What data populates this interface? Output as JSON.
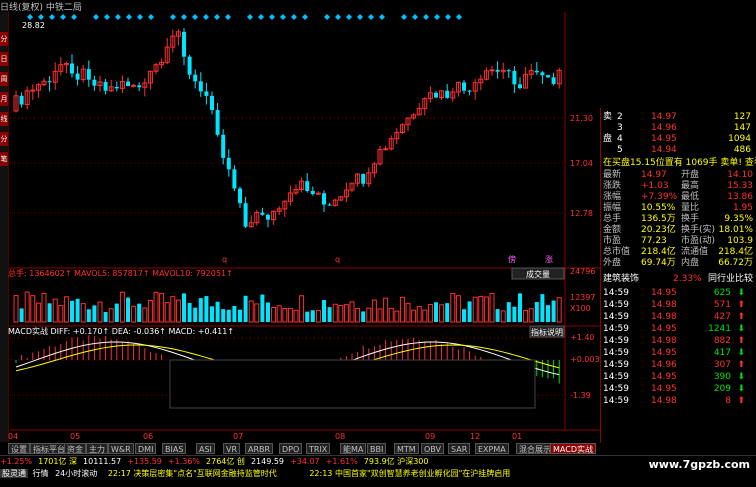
{
  "title": "日线(复权) 中铁二局",
  "left_buttons": [
    "分",
    "日",
    "周",
    "月",
    "线",
    "分",
    "笔"
  ],
  "price_axis": [
    "21.30",
    "17.04",
    "12.78"
  ],
  "max_label": "28.82",
  "markers": [
    "q",
    "q",
    "傍",
    "涨"
  ],
  "volume": {
    "label": "总手: 1364602↑  MAVOL5: 857817↑  MAVOL10: 792051↑",
    "type_button": "成交量",
    "axis": [
      "24796",
      "12397",
      "X100"
    ]
  },
  "macd": {
    "label": "MACD实战  DIFF: +0.170↑  DEA: -0.036↑  MACD: +0.411↑",
    "button": "指标说明",
    "axis": [
      "+1.40",
      "+0.003",
      "-1.39"
    ]
  },
  "x_axis": [
    "04",
    "05",
    "06",
    "07",
    "08",
    "09",
    "12",
    "01"
  ],
  "tabs": [
    "设置",
    "指标平台",
    "资金",
    "主力",
    "W&R",
    "DMI",
    "BIAS",
    "ASI",
    "VR",
    "ARBR",
    "DPO",
    "TRIX",
    "能MA",
    "BBI",
    "MTM",
    "OBV",
    "SAR",
    "EXPMA",
    "混合展示",
    "MACD实战"
  ],
  "ticker": [
    {
      "t": "+1.25%",
      "c": "red"
    },
    {
      "t": "1701亿 深",
      "c": "yellow"
    },
    {
      "t": "10111.57",
      "c": "white"
    },
    {
      "t": "+135.59",
      "c": "red"
    },
    {
      "t": "+1.36%",
      "c": "red"
    },
    {
      "t": "2764亿 创",
      "c": "yellow"
    },
    {
      "t": "2149.59",
      "c": "white"
    },
    {
      "t": "+34.07",
      "c": "red"
    },
    {
      "t": "+1.61%",
      "c": "red"
    },
    {
      "t": "793.9亿 沪深300",
      "c": "yellow"
    }
  ],
  "ticker2": {
    "tab1": "股灵通",
    "tab2": "行情",
    "tab3": "24小时滚动",
    "news1": "22:17 决策层密集\"点名\"互联网金融持监管时代",
    "news2": "22:13 中国首家\"双创智慧养老创业孵化园\"在沪挂牌启用"
  },
  "watermark": "www.7gpzb.com",
  "panel": {
    "sell_label": "卖",
    "buy_label": "盘",
    "sell_rows": [
      {
        "n": "2",
        "p": "14.97",
        "v": "127"
      },
      {
        "n": "3",
        "p": "14.96",
        "v": "147"
      },
      {
        "n": "4",
        "p": "14.95",
        "v": "1094"
      },
      {
        "n": "5",
        "p": "14.94",
        "v": "486"
      }
    ],
    "buy_info": "在买盘15.15位置有 1069手  卖单! 查看详细",
    "stats": [
      [
        "最新",
        "14.97",
        "开盘",
        "14.10"
      ],
      [
        "涨跌",
        "+1.03",
        "最高",
        "15.33"
      ],
      [
        "涨幅",
        "+7.39%",
        "最低",
        "13.86"
      ],
      [
        "振幅",
        "10.55%",
        "量比",
        "1.95"
      ],
      [
        "总手",
        "136.5万",
        "换手",
        "9.35%"
      ],
      [
        "金额",
        "20.23亿",
        "换手(实)",
        "18.01%"
      ],
      [
        "市盈",
        "77.23",
        "市盈(动)",
        "103.9"
      ],
      [
        "总市值",
        "218.4亿",
        "流通值",
        "218.4亿"
      ],
      [
        "外盘",
        "69.74万",
        "内盘",
        "66.72万"
      ]
    ],
    "industry": "建筑装饰",
    "industry_chg": "2.33%",
    "industry_link": "同行业比较",
    "ticks": [
      {
        "t": "14:59",
        "p": "14.95",
        "v": "625",
        "d": "down"
      },
      {
        "t": "14:59",
        "p": "14.98",
        "v": "571",
        "d": "up"
      },
      {
        "t": "14:59",
        "p": "14.98",
        "v": "427",
        "d": "up"
      },
      {
        "t": "14:59",
        "p": "14.95",
        "v": "1241",
        "d": "down"
      },
      {
        "t": "14:59",
        "p": "14.98",
        "v": "882",
        "d": "up"
      },
      {
        "t": "14:59",
        "p": "14.95",
        "v": "417",
        "d": "down"
      },
      {
        "t": "14:59",
        "p": "14.96",
        "v": "307",
        "d": "up"
      },
      {
        "t": "14:59",
        "p": "14.95",
        "v": "390",
        "d": "down"
      },
      {
        "t": "14:59",
        "p": "14.95",
        "v": "209",
        "d": "down"
      },
      {
        "t": "14:59",
        "p": "14.98",
        "v": "8",
        "d": "up"
      }
    ]
  },
  "colors": {
    "up": "#ff3030",
    "down": "#00e5ff",
    "ma1": "#ffffff",
    "ma2": "#ffff00",
    "grid": "#8b0000"
  }
}
